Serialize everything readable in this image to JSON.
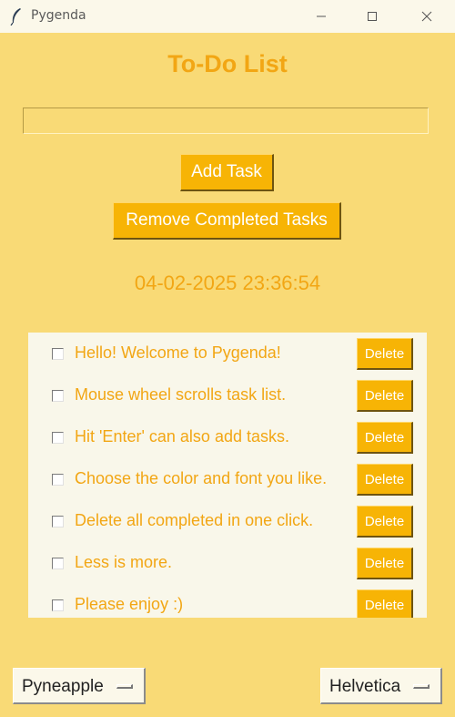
{
  "window": {
    "title": "Pygenda"
  },
  "heading": "To-Do List",
  "input": {
    "value": ""
  },
  "buttons": {
    "add": "Add Task",
    "remove_completed": "Remove Completed Tasks"
  },
  "clock": "04-02-2025 23:36:54",
  "tasks": [
    {
      "label": "Hello! Welcome to Pygenda!",
      "checked": false,
      "delete": "Delete"
    },
    {
      "label": "Mouse wheel scrolls task list.",
      "checked": false,
      "delete": "Delete"
    },
    {
      "label": "Hit 'Enter' can also add tasks.",
      "checked": false,
      "delete": "Delete"
    },
    {
      "label": "Choose the color and font you like.",
      "checked": false,
      "delete": "Delete"
    },
    {
      "label": "Delete all completed in one click.",
      "checked": false,
      "delete": "Delete"
    },
    {
      "label": "Less is more.",
      "checked": false,
      "delete": "Delete"
    },
    {
      "label": "Please enjoy :)",
      "checked": false,
      "delete": "Delete"
    }
  ],
  "theme_select": {
    "value": "Pyneapple"
  },
  "font_select": {
    "value": "Helvetica"
  },
  "colors": {
    "background": "#f9da76",
    "accent": "#f7b405",
    "text": "#f2a614",
    "panel": "#f9f7ea"
  },
  "icons": {
    "app": "feather-icon",
    "minimize": "minimize-icon",
    "maximize": "maximize-icon",
    "close": "close-icon"
  }
}
